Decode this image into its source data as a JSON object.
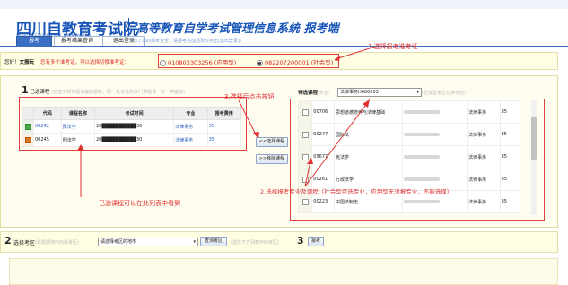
{
  "header": {
    "logo_cn": "四川自教育考试院",
    "logo_en": "SICHUAN EDUCATIONAL EXAMINATION",
    "system_title": "高等教育自学考试管理信息系统 报考端"
  },
  "tabs": [
    {
      "label": "报考"
    },
    {
      "label": "报考结果查询"
    },
    {
      "label": "退出登录"
    }
  ],
  "tab_hint": "(为了您的报考安全，请报考完成后及时点击[退出登录])",
  "cert_bar": {
    "greeting": "您好！",
    "user_name": "文振玩",
    "message": "您有多个准考证，可以选择切换准考证：",
    "option1": "010803303256 (应用型)",
    "option2": "082207200001 (社会型)"
  },
  "annotations": {
    "select_cert": "1.选择报考准考证",
    "click_button": "3.选择后点击按钮",
    "select_major": "2.选择报考专业及课程（社会型可选专业，应用型无须报专业，不能选择）",
    "selected_visible": "已选课程可以在此列表中看到"
  },
  "selected_panel": {
    "num": "1",
    "title": "已选课程",
    "hint": "(若选不到课程请提前报名，同一批考证的多门课程请一次一并提前)",
    "headers": [
      "代码",
      "课程名称",
      "考试时间",
      "专业",
      "报考费用"
    ],
    "rows": [
      {
        "code": "00242",
        "name": "民法学",
        "time": "20██████████30",
        "major": "法律事务",
        "fee": "35"
      },
      {
        "code": "00245",
        "name": "刑法学",
        "time": "20██████████30",
        "major": "法律事务",
        "fee": "35"
      }
    ]
  },
  "buttons": {
    "add": "<<选择课程",
    "remove": ">>移除课程",
    "query": "查询考区",
    "signup": "报考"
  },
  "pending_panel": {
    "title": "待选课程",
    "major_label": "专业:",
    "major_value": "法律事务H680503",
    "major_hint": "(社会型考生切换专业)",
    "rows": [
      {
        "code": "00706",
        "name": "思想道德修养与法律基础",
        "major": "法律事务",
        "fee": "35"
      },
      {
        "code": "00247",
        "name": "国际法",
        "major": "法律事务",
        "fee": "35"
      },
      {
        "code": "05677",
        "name": "宪法学",
        "major": "法律事务",
        "fee": "35"
      },
      {
        "code": "00261",
        "name": "行政法学",
        "major": "法律事务",
        "fee": "35"
      },
      {
        "code": "00223",
        "name": "中国法制史",
        "major": "法律事务",
        "fee": "35"
      }
    ]
  },
  "bottom": {
    "num": "2",
    "title": "选择考区",
    "hint": "(请根据地市的报考区)",
    "select_value": "请选择考区的地市",
    "after_hint": "(选择下方列表中的考区)",
    "num3": "3"
  }
}
